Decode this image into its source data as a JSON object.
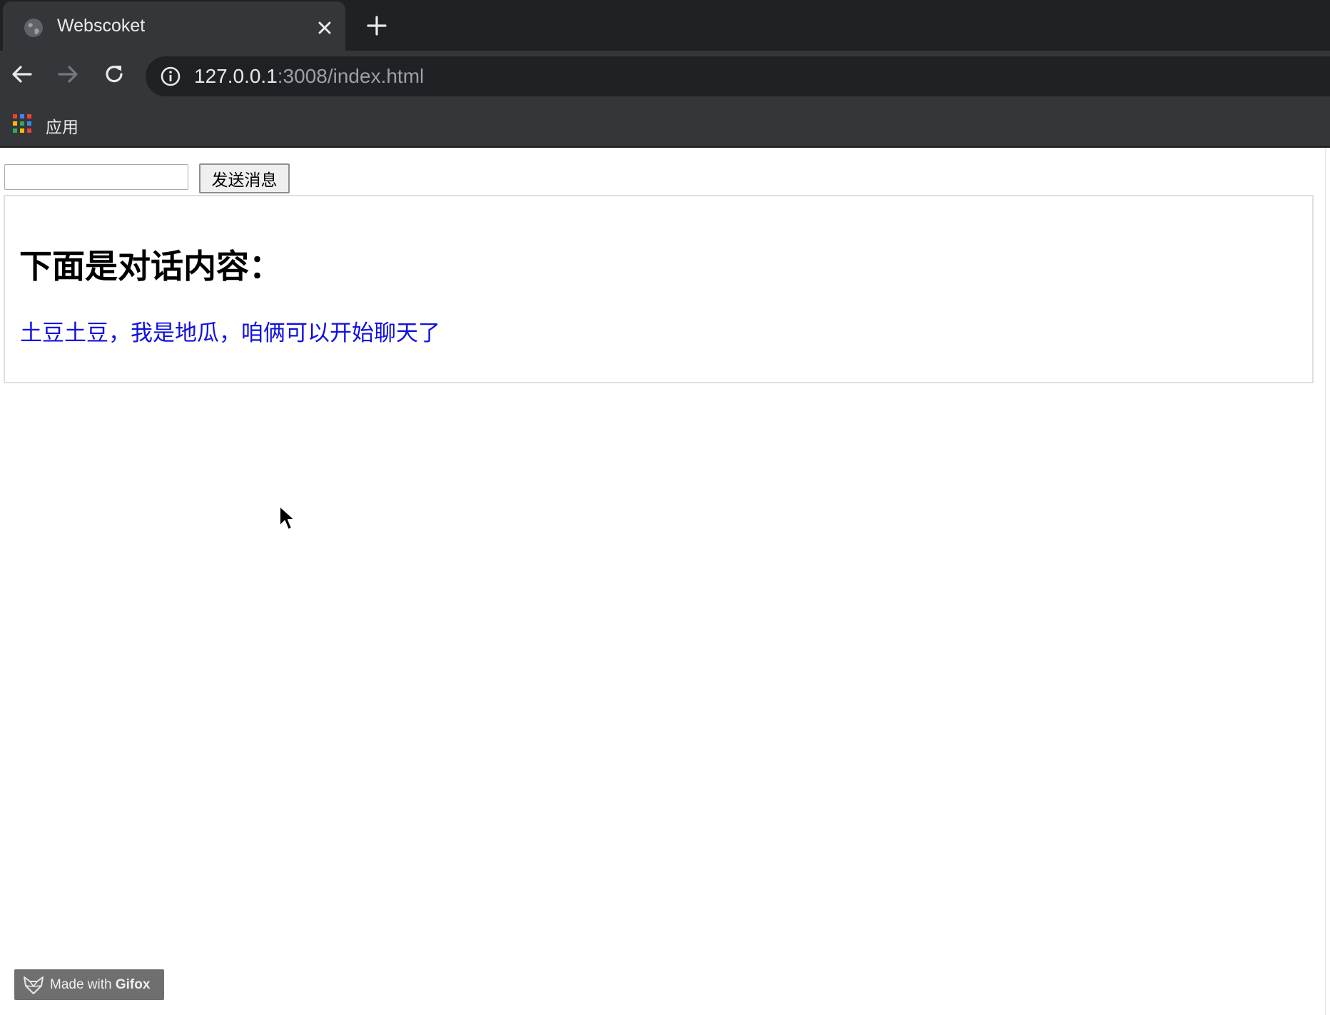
{
  "browser": {
    "tab": {
      "title": "Webscoket",
      "favicon": "globe-icon",
      "close_icon": "close-icon"
    },
    "new_tab_icon": "plus-icon",
    "nav": {
      "back_icon": "arrow-left-icon",
      "forward_icon": "arrow-right-icon",
      "reload_icon": "reload-icon"
    },
    "address_bar": {
      "info_icon": "info-icon",
      "url_host": "127.0.0.1",
      "url_rest": ":3008/index.html"
    },
    "bookmarks_bar": {
      "apps_icon": "apps-grid-icon",
      "apps_label": "应用"
    },
    "colors": {
      "tabstrip_bg": "#202124",
      "toolbar_bg": "#35363a",
      "text_light": "#e8eaed",
      "text_dim": "#9aa0a6"
    }
  },
  "page": {
    "message_input": {
      "value": "",
      "placeholder": ""
    },
    "send_button_label": "发送消息",
    "chat": {
      "heading": "下面是对话内容：",
      "messages": [
        {
          "text": "土豆土豆，我是地瓜，咱俩可以开始聊天了",
          "color": "#1010e0"
        }
      ]
    }
  },
  "overlay": {
    "cursor_icon": "mouse-pointer-icon",
    "watermark": {
      "prefix": "Made with ",
      "brand": "Gifox",
      "icon": "fox-icon"
    }
  }
}
